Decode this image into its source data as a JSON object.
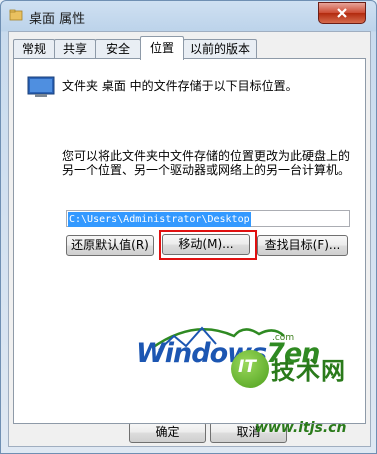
{
  "window": {
    "title": "桌面 属性"
  },
  "tabs": [
    {
      "label": "常规"
    },
    {
      "label": "共享"
    },
    {
      "label": "安全"
    },
    {
      "label": "位置"
    },
    {
      "label": "以前的版本"
    }
  ],
  "location": {
    "description": "文件夹 桌面 中的文件存储于以下目标位置。",
    "explanation": "您可以将此文件夹中文件存储的位置更改为此硬盘上的另一个位置、另一个驱动器或网络上的另一台计算机。",
    "path_value": "C:\\Users\\Administrator\\Desktop",
    "restore_default_label": "还原默认值(R)",
    "move_label": "移动(M)...",
    "find_target_label": "查找目标(F)..."
  },
  "footer": {
    "ok_label": "确定",
    "cancel_label": "取消"
  },
  "watermark": {
    "logo_text_a": "Windows",
    "logo_text_b": "7en",
    "logo_com": ".com",
    "badge_mark": "IT",
    "badge_title": "技术网",
    "badge_url": "www.itjs.cn"
  },
  "colors": {
    "highlight": "#e01010",
    "selection": "#3399ff",
    "titlebar": "#bcd3ea"
  }
}
